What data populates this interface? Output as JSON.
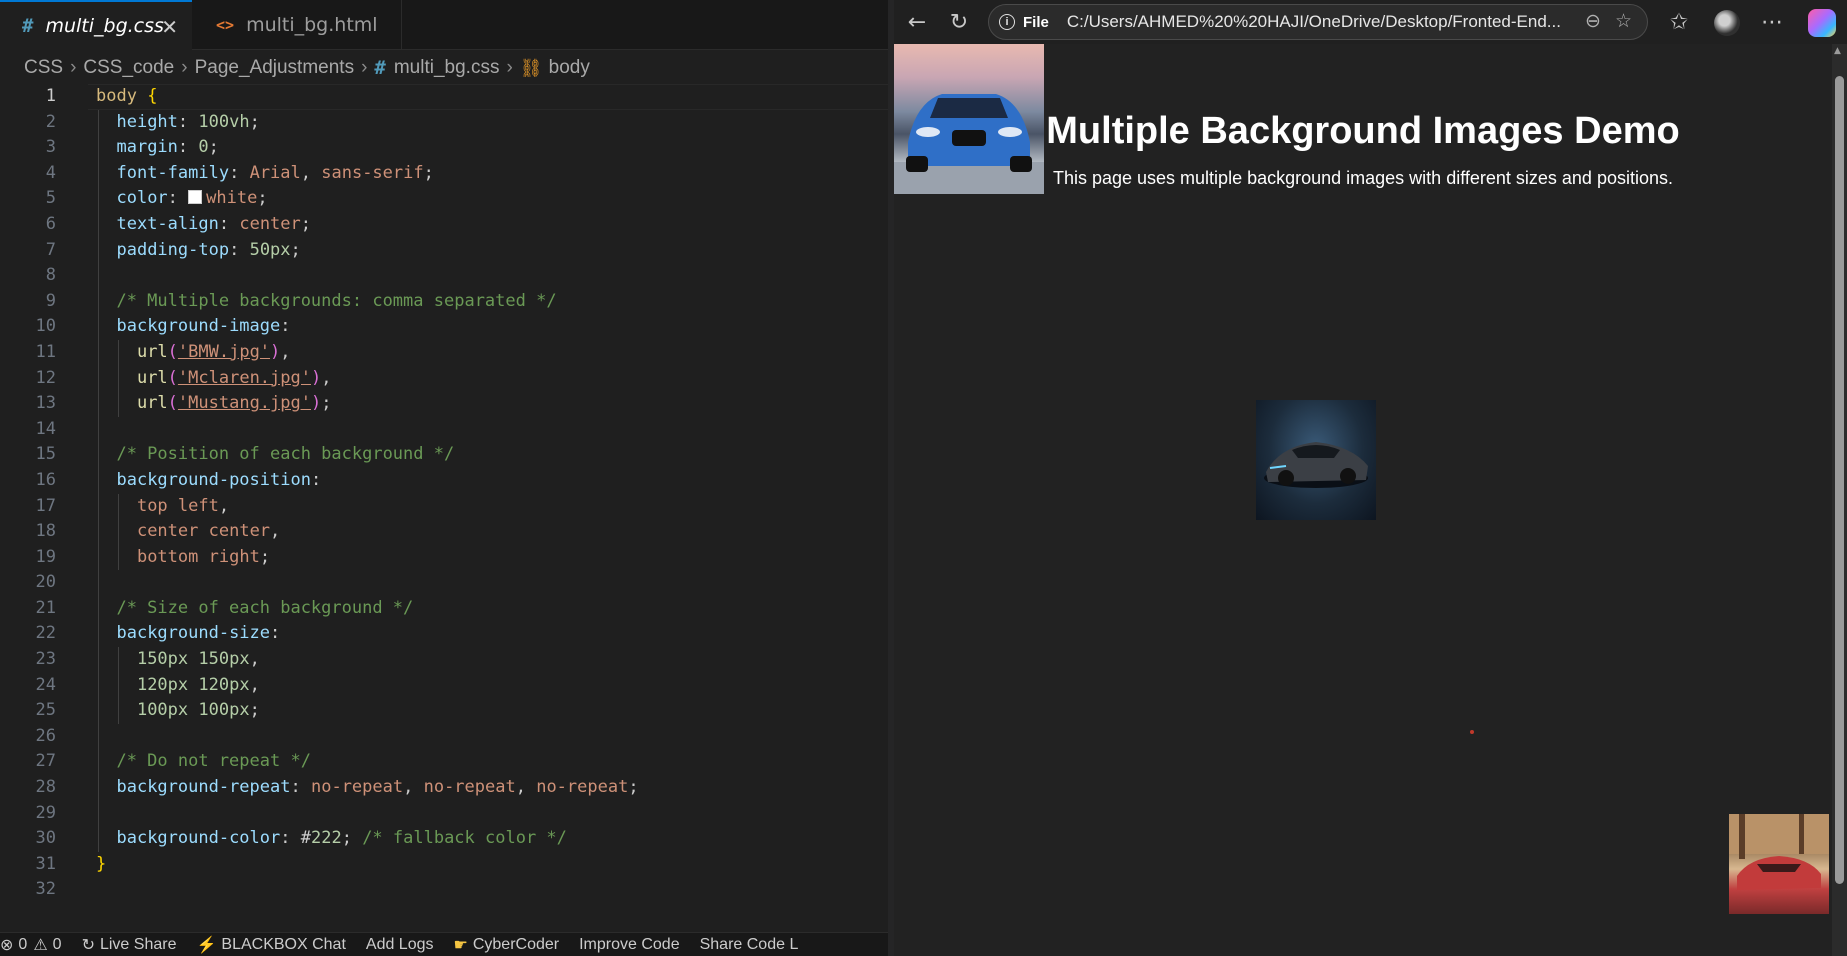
{
  "editor": {
    "tabs": [
      {
        "icon": "#",
        "label": "multi_bg.css",
        "active": true
      },
      {
        "icon": "<>",
        "label": "multi_bg.html",
        "active": false
      }
    ],
    "breadcrumb": {
      "items": [
        "CSS",
        "CSS_code",
        "Page_Adjustments",
        "multi_bg.css",
        "body"
      ]
    },
    "code_lines": [
      "body {",
      "  height: 100vh;",
      "  margin: 0;",
      "  font-family: Arial, sans-serif;",
      "  color: white;",
      "  text-align: center;",
      "  padding-top: 50px;",
      "",
      "  /* Multiple backgrounds: comma separated */",
      "  background-image:",
      "    url('BMW.jpg'),",
      "    url('Mclaren.jpg'),",
      "    url('Mustang.jpg');",
      "",
      "  /* Position of each background */",
      "  background-position:",
      "    top left,",
      "    center center,",
      "    bottom right;",
      "",
      "  /* Size of each background */",
      "  background-size:",
      "    150px 150px,",
      "    120px 120px,",
      "    100px 100px;",
      "",
      "  /* Do not repeat */",
      "  background-repeat: no-repeat, no-repeat, no-repeat;",
      "",
      "  background-color: #222; /* fallback color */",
      "}",
      ""
    ],
    "current_line": 1
  },
  "statusbar": {
    "errors": "0",
    "warnings": "0",
    "items": [
      "Live Share",
      "BLACKBOX Chat",
      "Add Logs",
      "CyberCoder",
      "Improve Code",
      "Share Code L"
    ]
  },
  "browser": {
    "address_chip": "File",
    "url": "C:/Users/AHMED%20%20HAJI/OneDrive/Desktop/Fronted-End...",
    "page": {
      "heading": "Multiple Background Images Demo",
      "text": "This page uses multiple background images with different sizes and positions."
    }
  },
  "colors": {
    "editor_bg": "#1f1f1f",
    "page_bg": "#222222",
    "accent": "#0078d4"
  }
}
